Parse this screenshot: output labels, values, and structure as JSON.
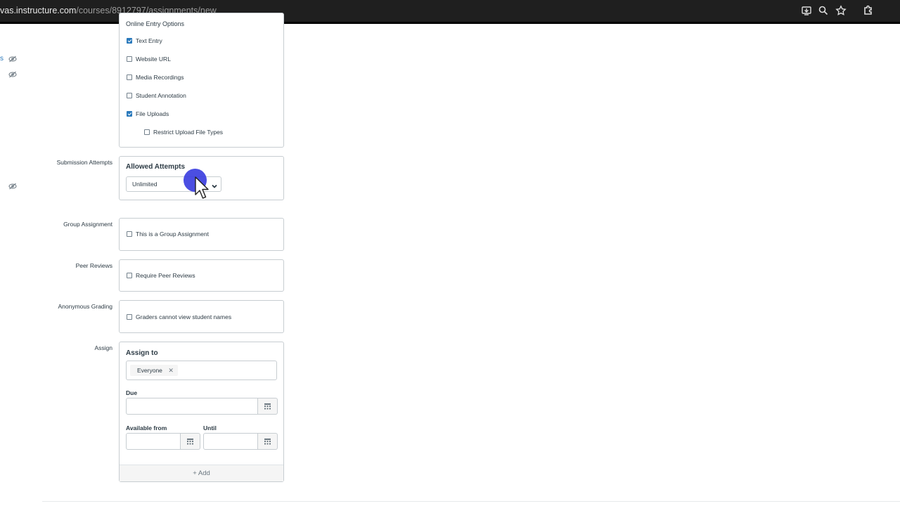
{
  "browser": {
    "url_host": "vas.instructure.com",
    "url_path": "/courses/8912797/assignments/new",
    "icons": [
      "install-app-icon",
      "zoom-icon",
      "bookmark-star-icon",
      "extensions-icon"
    ]
  },
  "gutter": {
    "link_fragment": "s"
  },
  "online_entry": {
    "heading": "Online Entry Options",
    "options": [
      {
        "label": "Text Entry",
        "checked": true
      },
      {
        "label": "Website URL",
        "checked": false
      },
      {
        "label": "Media Recordings",
        "checked": false
      },
      {
        "label": "Student Annotation",
        "checked": false
      },
      {
        "label": "File Uploads",
        "checked": true
      }
    ],
    "restrict": {
      "label": "Restrict Upload File Types",
      "checked": false
    }
  },
  "submission_attempts": {
    "row_label": "Submission Attempts",
    "heading": "Allowed Attempts",
    "selected": "Unlimited"
  },
  "group_assignment": {
    "row_label": "Group Assignment",
    "option": "This is a Group Assignment"
  },
  "peer_reviews": {
    "row_label": "Peer Reviews",
    "option": "Require Peer Reviews"
  },
  "anonymous_grading": {
    "row_label": "Anonymous Grading",
    "option": "Graders cannot view student names"
  },
  "assign": {
    "row_label": "Assign",
    "heading": "Assign to",
    "assignee": "Everyone",
    "remove_glyph": "✕",
    "due_label": "Due",
    "available_from_label": "Available from",
    "until_label": "Until",
    "add_label": "+ Add"
  },
  "colors": {
    "accent": "#2b7abc",
    "cursor_highlight": "#3c3fe0",
    "border": "#c7cdd1",
    "text": "#2d3b45"
  }
}
